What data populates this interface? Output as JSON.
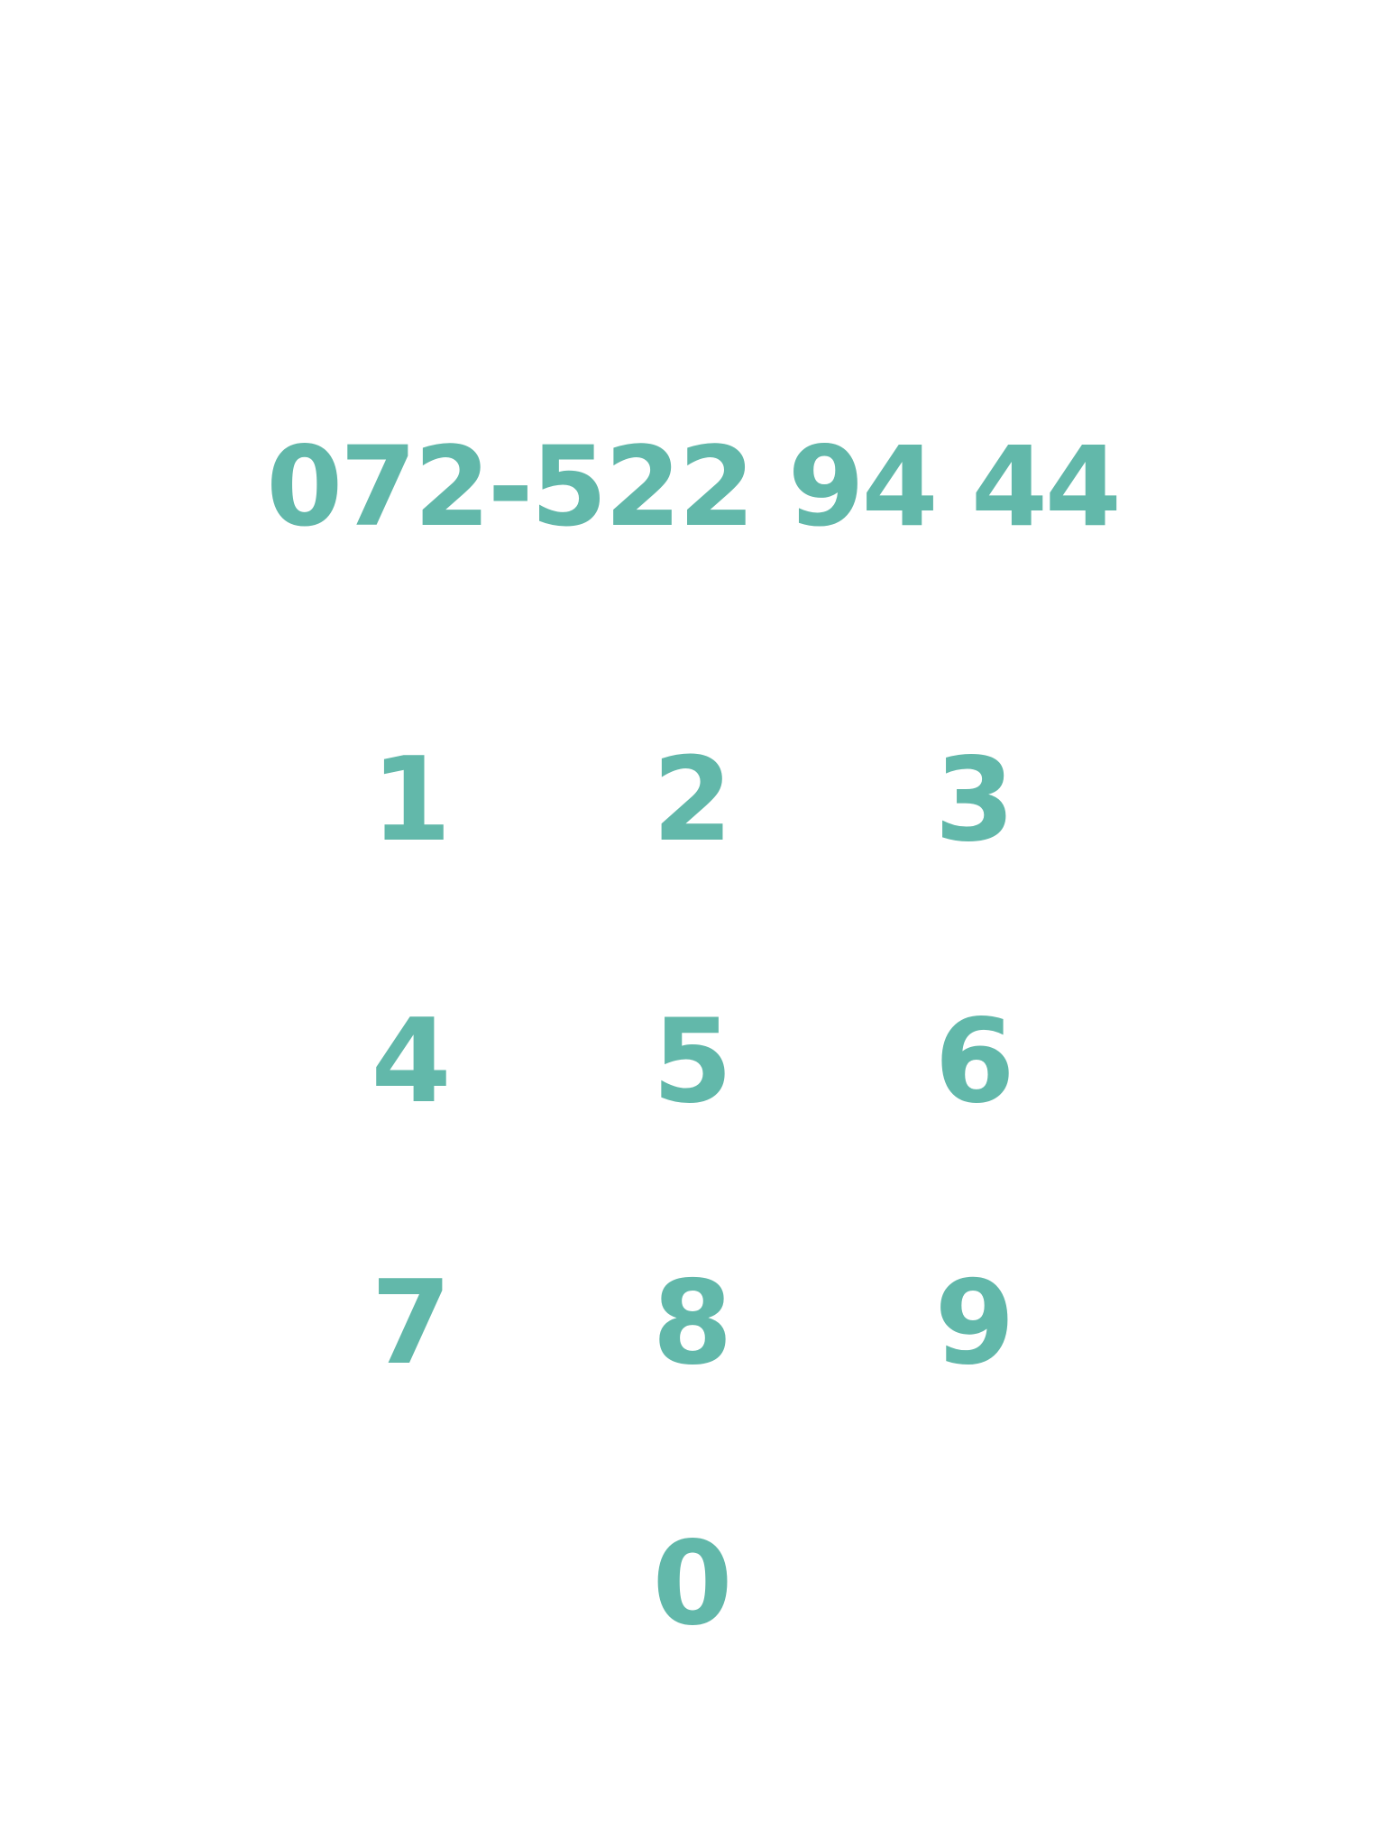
{
  "dialer": {
    "number": "072-522 94 44",
    "accent_color": "#62b8aa",
    "keys": [
      "1",
      "2",
      "3",
      "4",
      "5",
      "6",
      "7",
      "8",
      "9",
      "0"
    ]
  }
}
